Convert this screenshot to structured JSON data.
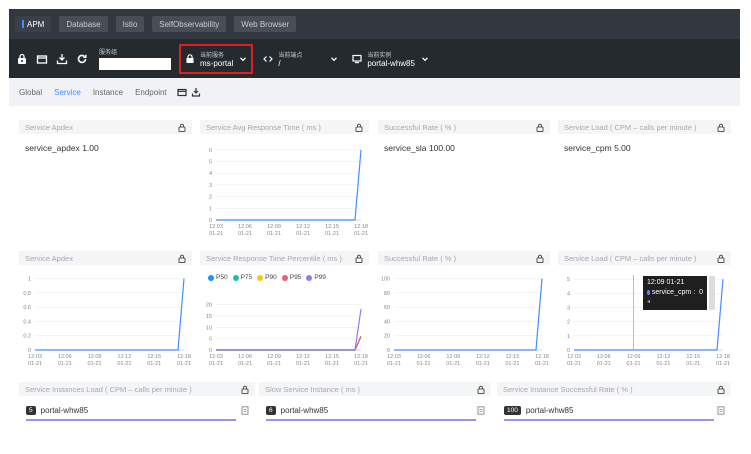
{
  "top_nav": {
    "tabs": [
      {
        "label": "APM",
        "active": true
      },
      {
        "label": "Database",
        "active": false
      },
      {
        "label": "Istio",
        "active": false
      },
      {
        "label": "SelfObservability",
        "active": false
      },
      {
        "label": "Web Browser",
        "active": false
      }
    ]
  },
  "toolbar": {
    "group_label": "服务组",
    "group_value": "",
    "service": {
      "label": "当前服务",
      "value": "ms-portal"
    },
    "endpoint": {
      "label": "当前端点",
      "value": "/"
    },
    "instance": {
      "label": "当前实例",
      "value": "portal-whw85"
    }
  },
  "subtabs": [
    {
      "label": "Global",
      "active": false
    },
    {
      "label": "Service",
      "active": true
    },
    {
      "label": "Instance",
      "active": false
    },
    {
      "label": "Endpoint",
      "active": false
    }
  ],
  "panels": {
    "apdex_value": {
      "title": "Service Apdex",
      "label": "service_apdex",
      "value": "1.00"
    },
    "avg_response": {
      "title": "Service Avg Response Time ( ms )"
    },
    "sla_value": {
      "title": "Successful Rate ( % )",
      "label": "service_sla",
      "value": "100.00"
    },
    "cpm_value": {
      "title": "Service Load ( CPM – calls per minute )",
      "label": "service_cpm",
      "value": "5.00"
    },
    "apdex_chart": {
      "title": "Service Apdex"
    },
    "percentile": {
      "title": "Service Response Time Percentile ( ms )"
    },
    "sla_chart": {
      "title": "Successful Rate ( % )"
    },
    "cpm_chart": {
      "title": "Service Load ( CPM – calls per minute )"
    },
    "instances_load": {
      "title": "Service Instances Load ( CPM – calls per minute )",
      "count": "5",
      "instance": "portal-whw85"
    },
    "slow_instance": {
      "title": "Slow Service Instance ( ms )",
      "count": "6",
      "instance": "portal-whw85"
    },
    "instance_sla": {
      "title": "Service Instance Successful Rate ( % )",
      "count": "100",
      "instance": "portal-whw85"
    }
  },
  "tooltip": {
    "time": "12:09 01-21",
    "series": "service_cpm",
    "value": "0"
  },
  "colors": {
    "accent": "#448dfe",
    "nav_bg": "#333840",
    "toolbar_bg": "#252a2f",
    "line": "#448dfe",
    "list_bar": "#a58ee8",
    "highlight_border": "#e02020"
  },
  "chart_data": [
    {
      "id": "avg_response",
      "type": "line",
      "x": [
        "12:03\n01-21",
        "12:06\n01-21",
        "12:09\n01-21",
        "12:12\n01-21",
        "12:15\n01-21",
        "12:18\n01-21"
      ],
      "series": [
        {
          "values": [
            0,
            0,
            0,
            0,
            0,
            6
          ]
        }
      ],
      "yticks": [
        0,
        1,
        2,
        3,
        4,
        5,
        6
      ],
      "ylim": [
        0,
        6.5
      ],
      "color": "#448dfe"
    },
    {
      "id": "apdex",
      "type": "line",
      "x": [
        "12:03\n01-21",
        "12:06\n01-21",
        "12:09\n01-21",
        "12:12\n01-21",
        "12:15\n01-21",
        "12:18\n01-21"
      ],
      "series": [
        {
          "values": [
            0,
            0,
            0,
            0,
            0,
            1
          ]
        }
      ],
      "yticks": [
        0,
        0.2,
        0.4,
        0.6,
        0.8,
        1
      ],
      "ylim": [
        0,
        1.05
      ],
      "color": "#448dfe"
    },
    {
      "id": "percentile",
      "type": "line",
      "x": [
        "12:03\n01-21",
        "12:06\n01-21",
        "12:09\n01-21",
        "12:12\n01-21",
        "12:15\n01-21",
        "12:18\n01-21"
      ],
      "series": [
        {
          "name": "P50",
          "color": "#1e90ff",
          "values": [
            0,
            0,
            0,
            0,
            0,
            6
          ]
        },
        {
          "name": "P75",
          "color": "#20c0a8",
          "values": [
            0,
            0,
            0,
            0,
            0,
            6
          ]
        },
        {
          "name": "P90",
          "color": "#f5c518",
          "values": [
            0,
            0,
            0,
            0,
            0,
            6
          ]
        },
        {
          "name": "P95",
          "color": "#f05a7a",
          "values": [
            0,
            0,
            0,
            0,
            0,
            6
          ]
        },
        {
          "name": "P99",
          "color": "#8b7ff0",
          "values": [
            0,
            0,
            0,
            0,
            0,
            18
          ]
        }
      ],
      "yticks": [
        0,
        5,
        10,
        15,
        20
      ],
      "ylim": [
        0,
        22
      ],
      "color": "#8b7ff0"
    },
    {
      "id": "sla",
      "type": "line",
      "x": [
        "12:03\n01-21",
        "12:06\n01-21",
        "12:09\n01-21",
        "12:12\n01-21",
        "12:15\n01-21",
        "12:18\n01-21"
      ],
      "series": [
        {
          "values": [
            0,
            0,
            0,
            0,
            0,
            100
          ]
        }
      ],
      "yticks": [
        0,
        20,
        40,
        60,
        80,
        100
      ],
      "ylim": [
        0,
        105
      ],
      "color": "#448dfe"
    },
    {
      "id": "cpm",
      "type": "line",
      "x": [
        "12:03\n01-21",
        "12:06\n01-21",
        "12:09\n01-21",
        "12:12\n01-21",
        "12:15\n01-21",
        "12:18\n01-21"
      ],
      "series": [
        {
          "values": [
            0,
            0,
            0,
            0,
            0,
            5
          ]
        }
      ],
      "yticks": [
        0,
        1,
        2,
        3,
        4,
        5
      ],
      "ylim": [
        0,
        5.3
      ],
      "color": "#448dfe"
    }
  ]
}
